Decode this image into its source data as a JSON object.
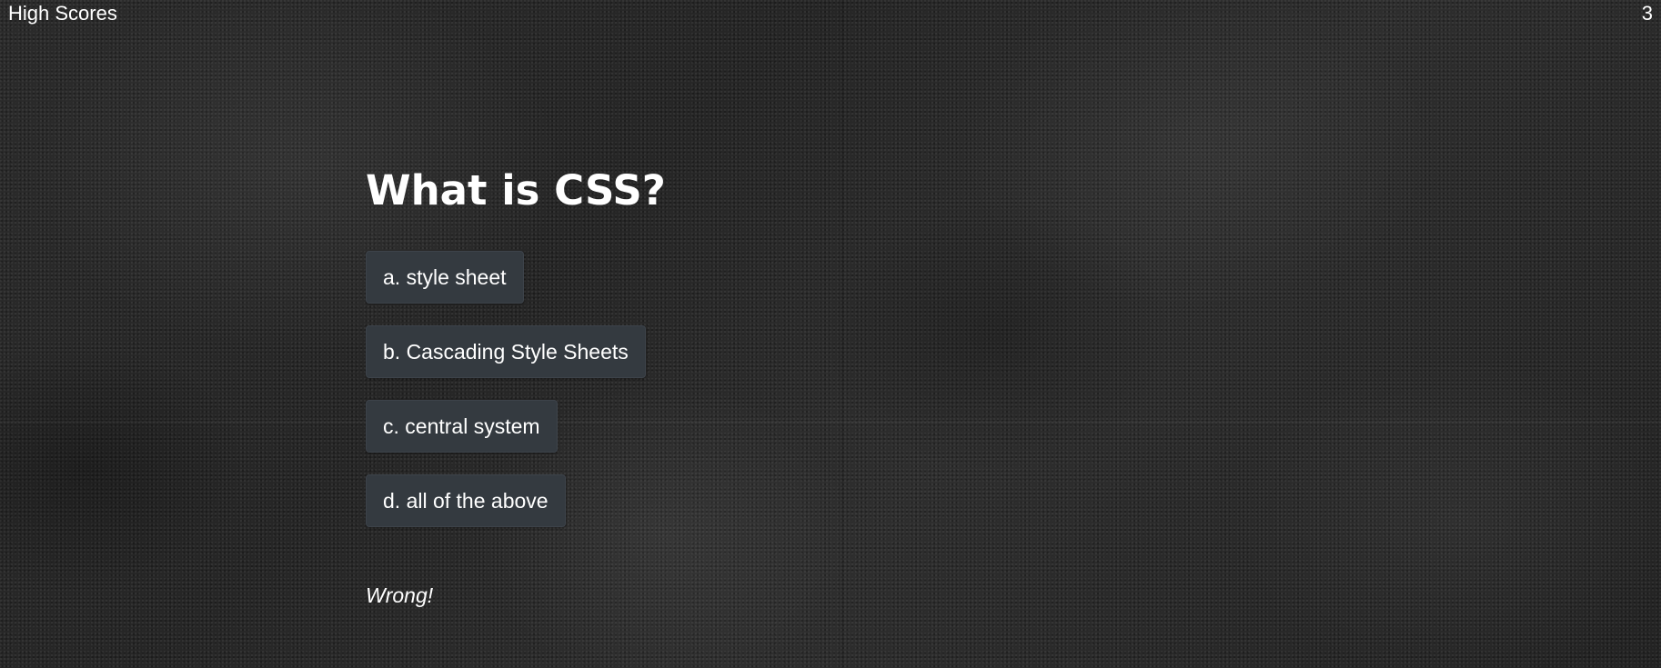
{
  "header": {
    "high_scores_link": "High Scores",
    "timer_value": "3"
  },
  "quiz": {
    "question": "What is CSS?",
    "choices": [
      "a. style sheet",
      "b. Cascading Style Sheets",
      "c. central system",
      "d. all of the above"
    ],
    "feedback": "Wrong!"
  },
  "colors": {
    "background": "#2a2a2a",
    "button": "#343a40",
    "text": "#ffffff"
  }
}
